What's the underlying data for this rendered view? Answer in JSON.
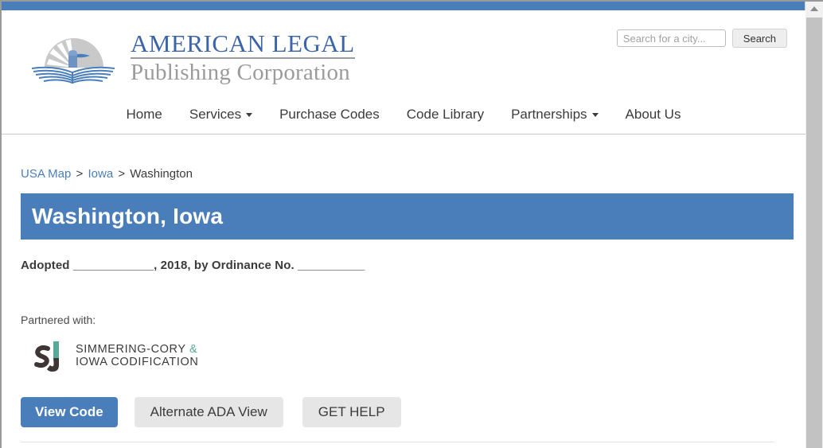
{
  "browser": {
    "scrollbar": {
      "up_arrow": "scroll-up-arrow"
    }
  },
  "header": {
    "logo": {
      "emblem_name": "sunrise-eagle-book-emblem",
      "line1": "AMERICAN LEGAL",
      "line2": "Publishing Corporation"
    },
    "search": {
      "placeholder": "Search for a city...",
      "value": "",
      "button_label": "Search"
    },
    "nav": [
      {
        "label": "Home",
        "has_caret": false
      },
      {
        "label": "Services",
        "has_caret": true
      },
      {
        "label": "Purchase Codes",
        "has_caret": false
      },
      {
        "label": "Code Library",
        "has_caret": false
      },
      {
        "label": "Partnerships",
        "has_caret": true
      },
      {
        "label": "About Us",
        "has_caret": false
      }
    ]
  },
  "main": {
    "breadcrumb": {
      "items": [
        {
          "label": "USA Map",
          "link": true
        },
        {
          "label": "Iowa",
          "link": true
        },
        {
          "label": "Washington",
          "link": false
        }
      ],
      "separator": ">"
    },
    "page_title": "Washington, Iowa",
    "adopted_text": "Adopted ____________, 2018, by Ordinance No. __________",
    "partner_label": "Partnered with:",
    "partner": {
      "mark_name": "simmering-cory-csj-logo",
      "line1_a": "SIMMERING-CORY ",
      "line1_amp": "&",
      "line2": "IOWA CODIFICATION"
    },
    "buttons": [
      {
        "label": "View Code",
        "style": "primary"
      },
      {
        "label": "Alternate ADA View",
        "style": "secondary"
      },
      {
        "label": "GET HELP",
        "style": "secondary"
      }
    ]
  },
  "colors": {
    "brand_blue": "#4a7ebb",
    "brand_gray": "#9b9b9b",
    "link_blue": "#4a7ebb",
    "teal": "#57a99a",
    "button_gray": "#e6e6e6"
  }
}
